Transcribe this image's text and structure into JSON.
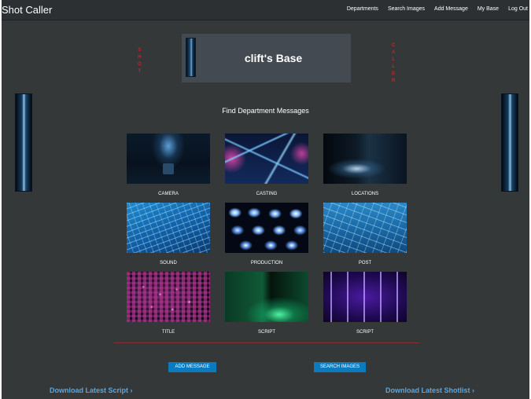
{
  "navbar": {
    "brand": "Shot Caller",
    "links": [
      "Departments",
      "Search Images",
      "Add Message",
      "My Base",
      "Log Out"
    ]
  },
  "side_text": {
    "left": [
      "S",
      "H",
      "O",
      "T"
    ],
    "right": [
      "C",
      "A",
      "L",
      "L",
      "E",
      "R"
    ]
  },
  "base": {
    "title": "clift's Base"
  },
  "departments": {
    "heading": "Find Department Messages",
    "tiles": [
      {
        "label": "CAMERA"
      },
      {
        "label": "CASTING"
      },
      {
        "label": "LOCATIONS"
      },
      {
        "label": "SOUND"
      },
      {
        "label": "PRODUCTION"
      },
      {
        "label": "POST"
      },
      {
        "label": "TITLE"
      },
      {
        "label": "SCRIPT"
      },
      {
        "label": "SCRIPT"
      }
    ]
  },
  "actions": {
    "add_message": "ADD MESSAGE",
    "search_images": "SEARCH IMAGES"
  },
  "downloads": {
    "script": "Download Latest Script",
    "shotlist": "Download Latest Shotlist",
    "chevron": "›"
  },
  "colors": {
    "background": "#343839",
    "navbar": "#2c3033",
    "accent_red": "#c4252b",
    "button_blue": "#0b7bbf",
    "link_blue": "#5aa7e0"
  }
}
